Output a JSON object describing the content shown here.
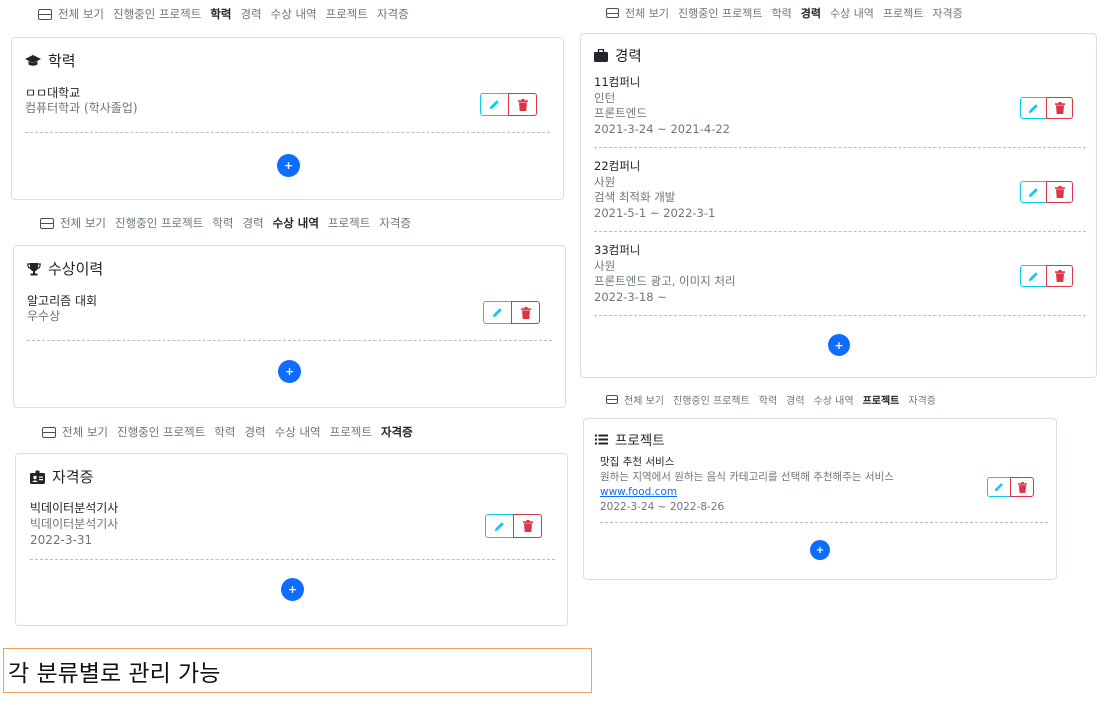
{
  "nav_tabs": [
    "전체 보기",
    "진행중인 프로젝트",
    "학력",
    "경력",
    "수상 내역",
    "프로젝트",
    "자격증"
  ],
  "education": {
    "title": "학력",
    "items": [
      {
        "line1": "ㅁㅁ대학교",
        "line2": "컴퓨터학과 (학사졸업)"
      }
    ]
  },
  "career": {
    "title": "경력",
    "items": [
      {
        "company": "11컴퍼니",
        "role": "인턴",
        "work": "프론트엔드",
        "period": "2021-3-24 ~ 2021-4-22"
      },
      {
        "company": "22컴퍼니",
        "role": "사원",
        "work": "검색 최적화 개발",
        "period": "2021-5-1 ~ 2022-3-1"
      },
      {
        "company": "33컴퍼니",
        "role": "사원",
        "work": "프론트엔드 광고, 이미지 처리",
        "period": "2022-3-18 ~"
      }
    ]
  },
  "awards": {
    "title": "수상이력",
    "items": [
      {
        "line1": "알고리즘 대회",
        "line2": "우수상"
      }
    ]
  },
  "projects": {
    "title": "프로젝트",
    "items": [
      {
        "name": "맛집 추천 서비스",
        "desc": "원하는 지역에서 원하는 음식 카테고리를 선택해 추천해주는 서비스",
        "link": "www.food.com",
        "period": "2022-3-24 ~ 2022-8-26"
      }
    ]
  },
  "certificates": {
    "title": "자격증",
    "items": [
      {
        "line1": "빅데이터분석기사",
        "line2": "빅데이터분석기사",
        "line3": "2022-3-31"
      }
    ]
  },
  "caption": "각 분류별로 관리 가능",
  "add_label": "+",
  "colors": {
    "primary": "#0d6efd",
    "info": "#0dcaf0",
    "danger": "#dc3545",
    "muted": "#6c757d",
    "caption_border": "#f0a061"
  },
  "icons": {
    "nav": "inbox-icon",
    "education": "graduation-cap-icon",
    "career": "briefcase-icon",
    "awards": "trophy-icon",
    "projects": "list-icon",
    "certificates": "id-badge-icon",
    "edit": "pencil-icon",
    "delete": "trash-icon"
  }
}
